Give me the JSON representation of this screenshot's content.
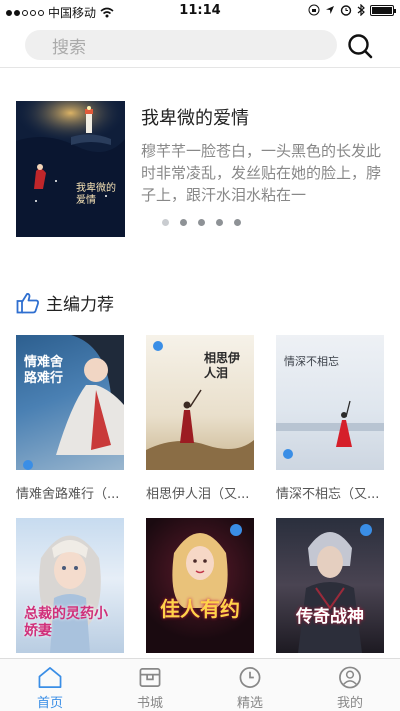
{
  "status": {
    "carrier": "中国移动",
    "time": "11:14"
  },
  "search": {
    "placeholder": "搜索"
  },
  "banner": {
    "title": "我卑微的爱情",
    "description": "穆芊芊一脸苍白，一头黑色的长发此时非常凌乱，发丝贴在她的脸上，脖子上，跟汗水泪水粘在一",
    "cover_title": "我卑微的爱情",
    "pages": 5,
    "active_page": 0
  },
  "recommend": {
    "title": "主编力荐",
    "books": [
      {
        "name": "情难舍路难行（...",
        "cover_title": "情难舍路难行"
      },
      {
        "name": "相思伊人泪（又...",
        "cover_title": "相思伊人泪"
      },
      {
        "name": "情深不相忘（又...",
        "cover_title": "情深不相忘"
      },
      {
        "name": "",
        "cover_title": "总裁的灵药小娇妻"
      },
      {
        "name": "",
        "cover_title": "佳人有约"
      },
      {
        "name": "",
        "cover_title": "传奇战神"
      }
    ]
  },
  "tabs": [
    {
      "label": "首页",
      "icon": "home-icon",
      "active": true
    },
    {
      "label": "书城",
      "icon": "store-icon",
      "active": false
    },
    {
      "label": "精选",
      "icon": "clock-icon",
      "active": false
    },
    {
      "label": "我的",
      "icon": "user-icon",
      "active": false
    }
  ],
  "colors": {
    "accent": "#3a8ee6",
    "search_bg": "#efefef"
  }
}
